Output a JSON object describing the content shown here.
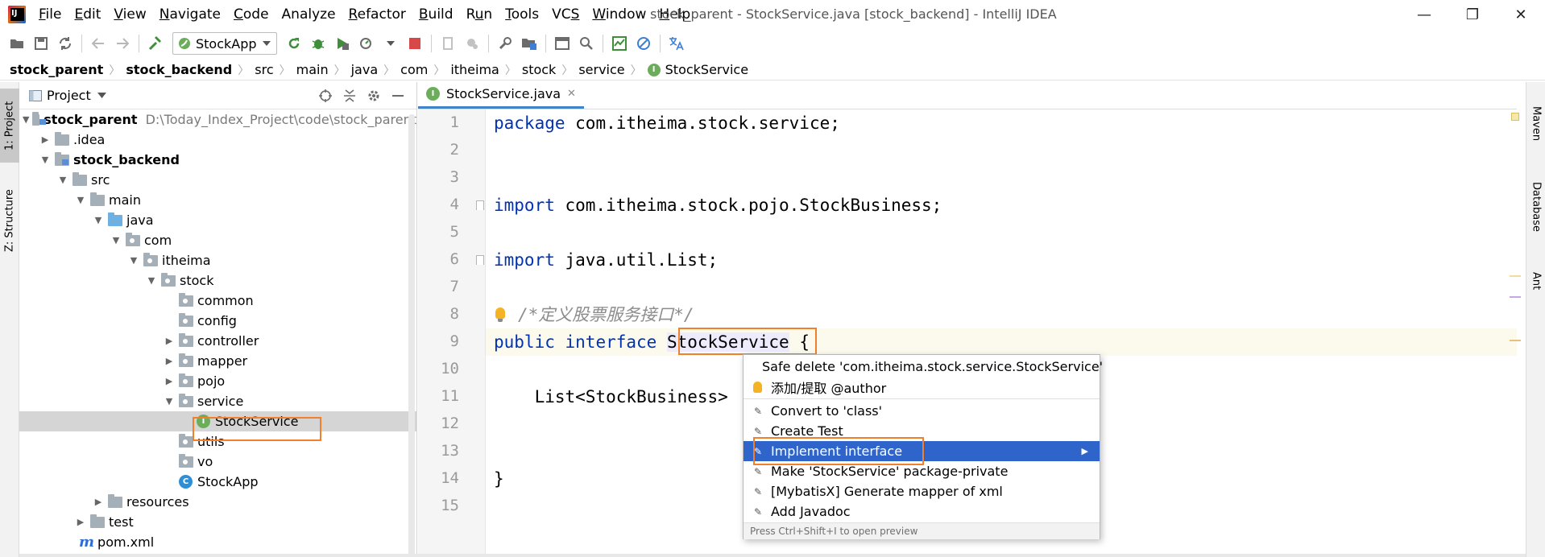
{
  "window": {
    "title": "stock_parent - StockService.java [stock_backend] - IntelliJ IDEA",
    "minimize": "—",
    "restore": "❐",
    "close": "✕"
  },
  "menu": [
    "File",
    "Edit",
    "View",
    "Navigate",
    "Code",
    "Analyze",
    "Refactor",
    "Build",
    "Run",
    "Tools",
    "VCS",
    "Window",
    "Help"
  ],
  "menu_mnemonics": [
    "F",
    "E",
    "V",
    "N",
    "C",
    "",
    "R",
    "B",
    "u",
    "T",
    "S",
    "W",
    "H"
  ],
  "toolbar": {
    "run_config": "StockApp"
  },
  "breadcrumb": [
    "stock_parent",
    "stock_backend",
    "src",
    "main",
    "java",
    "com",
    "itheima",
    "stock",
    "service",
    "StockService"
  ],
  "left_stripe": {
    "project_tab": "1: Project",
    "structure_tab": "Z: Structure"
  },
  "right_stripe": {
    "maven": "Maven",
    "database": "Database",
    "ant": "Ant"
  },
  "project_panel": {
    "title": "Project",
    "tree": [
      {
        "label": "stock_parent",
        "path": "D:\\Today_Index_Project\\code\\stock_parent"
      },
      {
        "label": ".idea"
      },
      {
        "label": "stock_backend"
      },
      {
        "label": "src"
      },
      {
        "label": "main"
      },
      {
        "label": "java"
      },
      {
        "label": "com"
      },
      {
        "label": "itheima"
      },
      {
        "label": "stock"
      },
      {
        "label": "common"
      },
      {
        "label": "config"
      },
      {
        "label": "controller"
      },
      {
        "label": "mapper"
      },
      {
        "label": "pojo"
      },
      {
        "label": "service"
      },
      {
        "label": "StockService"
      },
      {
        "label": "utils"
      },
      {
        "label": "vo"
      },
      {
        "label": "StockApp"
      },
      {
        "label": "resources"
      },
      {
        "label": "test"
      },
      {
        "label": "pom.xml"
      }
    ]
  },
  "editor": {
    "tab_label": "StockService.java",
    "line_numbers": [
      "1",
      "2",
      "3",
      "4",
      "5",
      "6",
      "7",
      "8",
      "9",
      "10",
      "11",
      "12",
      "13",
      "14",
      "15"
    ],
    "code": {
      "l1_kw": "package",
      "l1_rest": " com.itheima.stock.service;",
      "l4_kw": "import",
      "l4_rest": " com.itheima.stock.pojo.StockBusiness;",
      "l6_kw": "import",
      "l6_rest": " java.util.List;",
      "l8_comment": "/*定义股票服务接口*/",
      "l9_kw1": "public",
      "l9_kw2": "interface",
      "l9_ident": "StockService",
      "l9_brace": " {",
      "l11_text": "    List<StockBusiness>",
      "l14_text": "}"
    }
  },
  "popup": {
    "items": [
      "Safe delete 'com.itheima.stock.service.StockService'",
      "添加/提取 @author",
      "Convert to 'class'",
      "Create Test",
      "Implement interface",
      "Make 'StockService' package-private",
      "[MybatisX] Generate mapper of xml",
      "Add Javadoc"
    ],
    "footer": "Press Ctrl+Shift+I to open preview"
  },
  "colors": {
    "accent_selection": "#2f65ca",
    "highlight_box": "#f0802b",
    "keyword": "#0033b3",
    "comment": "#8c8c8c",
    "interface_icon": "#6cad5c"
  }
}
